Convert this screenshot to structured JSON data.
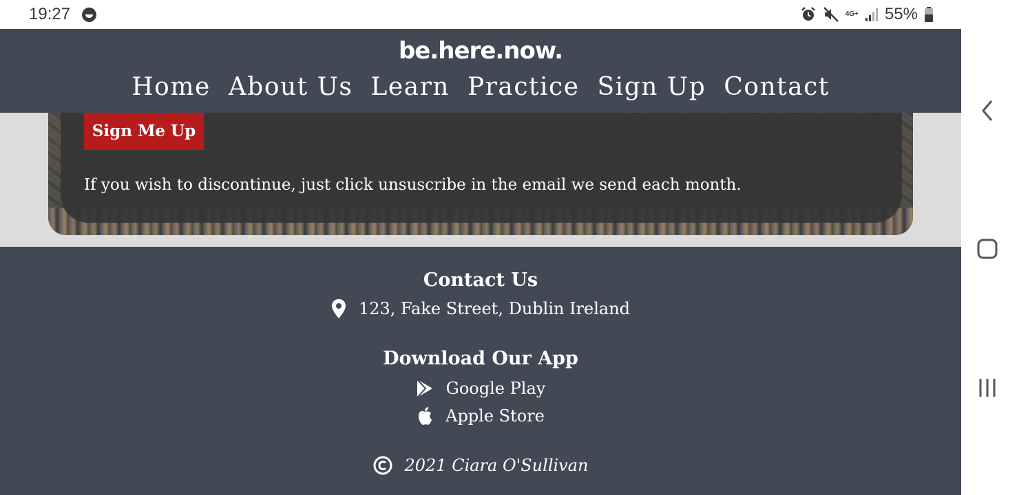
{
  "status_bar": {
    "time": "19:27",
    "network_label": "4G+",
    "battery_percent": "55%",
    "icons": [
      "face-icon",
      "alarm-icon",
      "mute-icon",
      "signal-icon",
      "battery-icon"
    ]
  },
  "header": {
    "logo": "be.here.now.",
    "nav": [
      "Home",
      "About Us",
      "Learn",
      "Practice",
      "Sign Up",
      "Contact"
    ]
  },
  "signup": {
    "button_label": "Sign Me Up",
    "unsubscribe_text": "If you wish to discontinue, just click unsuscribe in the email we send each month."
  },
  "footer": {
    "contact_heading": "Contact Us",
    "address": "123, Fake Street, Dublin Ireland",
    "app_heading": "Download Our App",
    "google_play": "Google Play",
    "apple_store": "Apple Store",
    "copyright": "2021 Ciara O'Sullivan"
  },
  "colors": {
    "header_bg": "#424854",
    "button_red": "#b71c1c",
    "page_bg": "#dcdcdc"
  }
}
